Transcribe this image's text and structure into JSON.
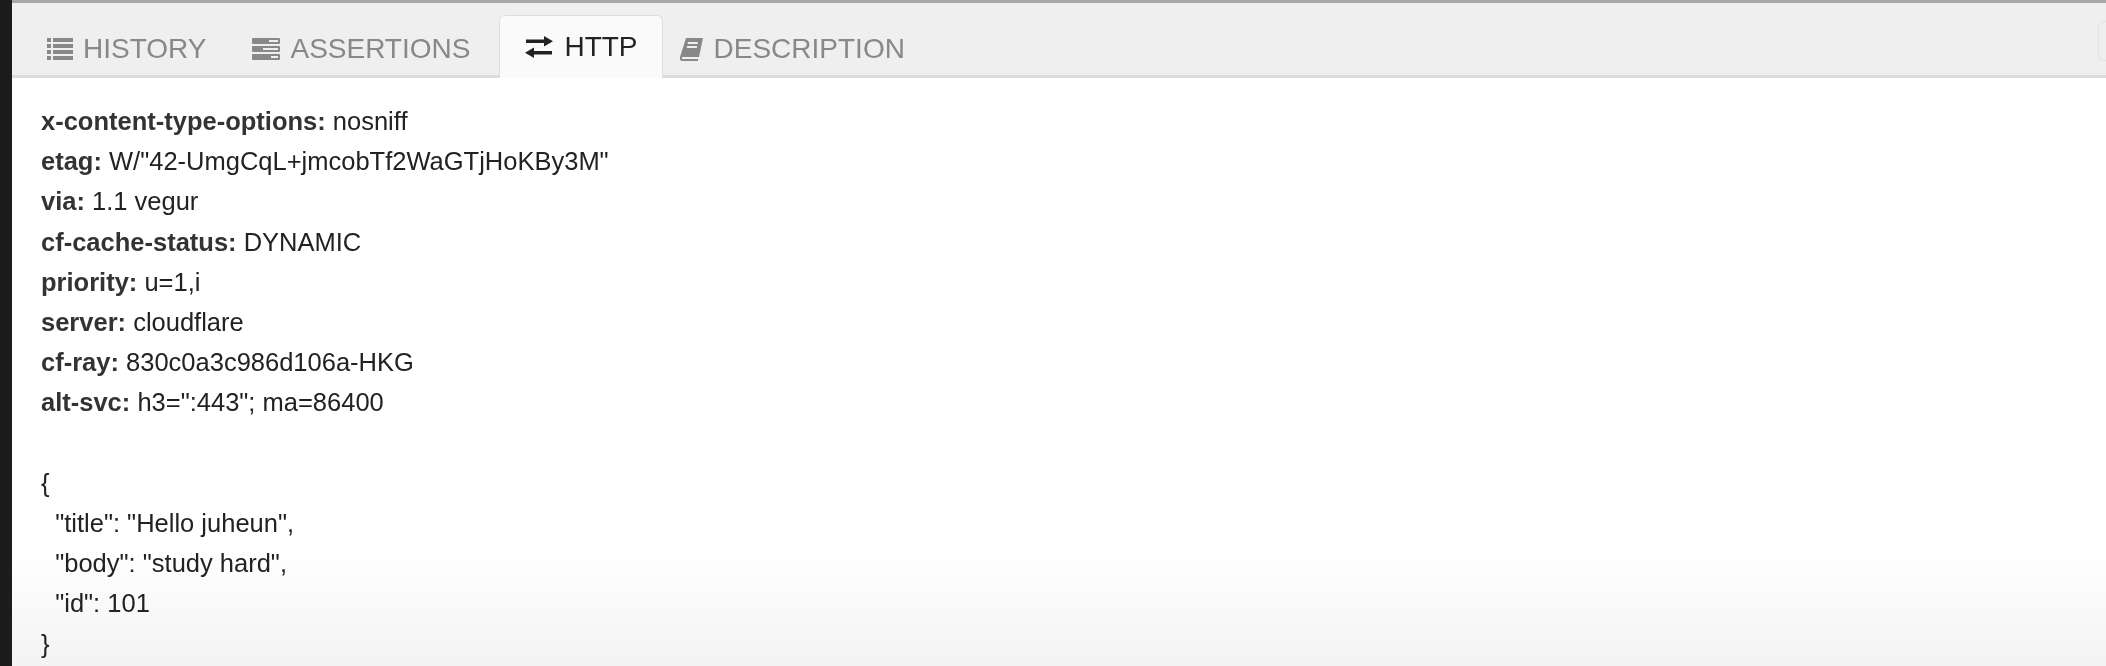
{
  "tabs": [
    {
      "label": "HISTORY",
      "kind": "list",
      "selected": false
    },
    {
      "label": "ASSERTIONS",
      "kind": "server",
      "selected": false
    },
    {
      "label": "HTTP",
      "kind": "exchange",
      "selected": true
    },
    {
      "label": "DESCRIPTION",
      "kind": "book",
      "selected": false
    }
  ],
  "response": {
    "headers": [
      {
        "name": "x-content-type-options:",
        "value": "nosniff"
      },
      {
        "name": "etag:",
        "value": "W/\"42-UmgCqL+jmcobTf2WaGTjHoKBy3M\""
      },
      {
        "name": "via:",
        "value": "1.1 vegur"
      },
      {
        "name": "cf-cache-status:",
        "value": "DYNAMIC"
      },
      {
        "name": "priority:",
        "value": "u=1,i"
      },
      {
        "name": "server:",
        "value": "cloudflare"
      },
      {
        "name": "cf-ray:",
        "value": "830c0a3c986d106a-HKG"
      },
      {
        "name": "alt-svc:",
        "value": "h3=\":443\"; ma=86400"
      }
    ],
    "body_lines": [
      "{",
      "  \"title\": \"Hello juheun\",",
      "  \"body\": \"study hard\",",
      "  \"id\": 101",
      "}"
    ]
  }
}
